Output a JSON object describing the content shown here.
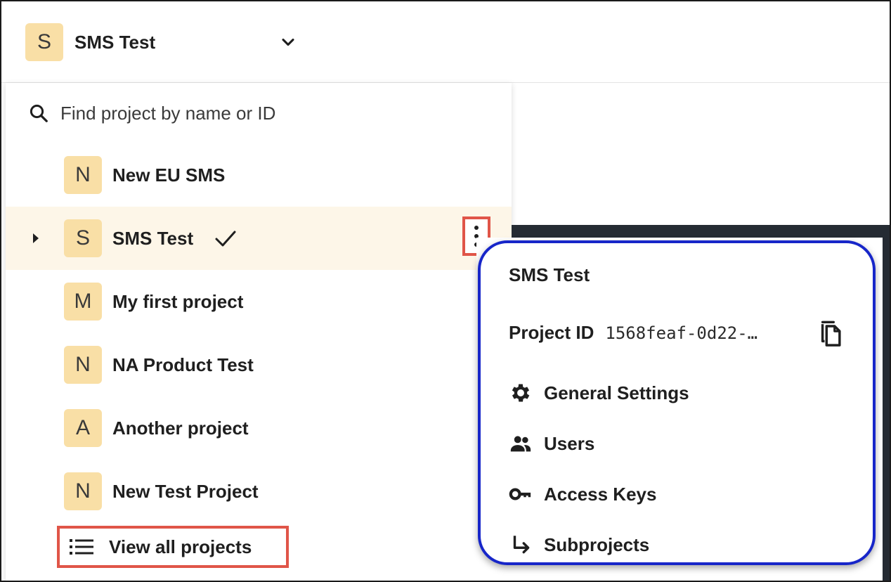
{
  "header": {
    "avatar_letter": "S",
    "project_name": "SMS Test"
  },
  "search": {
    "placeholder": "Find project by name or ID"
  },
  "projects": [
    {
      "letter": "N",
      "name": "New EU SMS"
    },
    {
      "letter": "S",
      "name": "SMS Test",
      "selected": true
    },
    {
      "letter": "M",
      "name": "My first project"
    },
    {
      "letter": "N",
      "name": "NA Product Test"
    },
    {
      "letter": "A",
      "name": "Another project"
    },
    {
      "letter": "N",
      "name": "New Test Project"
    }
  ],
  "view_all_label": "View all projects",
  "project_menu": {
    "title": "SMS Test",
    "project_id_label": "Project ID",
    "project_id_value": "1568feaf-0d22-…",
    "items": [
      {
        "label": "General Settings",
        "icon": "gear-icon"
      },
      {
        "label": "Users",
        "icon": "users-icon"
      },
      {
        "label": "Access Keys",
        "icon": "key-icon"
      },
      {
        "label": "Subprojects",
        "icon": "subdirectory-arrow-icon"
      }
    ]
  },
  "colors": {
    "avatar_bg": "#f9dfa6",
    "selected_row_bg": "#fdf6e8",
    "highlight_red": "#e05548",
    "highlight_blue": "#1726c9",
    "backdrop": "#252b33"
  }
}
